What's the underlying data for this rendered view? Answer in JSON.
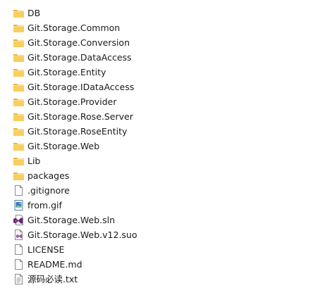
{
  "colors": {
    "folder": "#f5c54a",
    "folder_tab": "#e8b430",
    "text": "#1a1a1a"
  },
  "files": [
    {
      "name": "DB",
      "icon": "folder-icon"
    },
    {
      "name": "Git.Storage.Common",
      "icon": "folder-icon"
    },
    {
      "name": "Git.Storage.Conversion",
      "icon": "folder-icon"
    },
    {
      "name": "Git.Storage.DataAccess",
      "icon": "folder-icon"
    },
    {
      "name": "Git.Storage.Entity",
      "icon": "folder-icon"
    },
    {
      "name": "Git.Storage.IDataAccess",
      "icon": "folder-icon"
    },
    {
      "name": "Git.Storage.Provider",
      "icon": "folder-icon"
    },
    {
      "name": "Git.Storage.Rose.Server",
      "icon": "folder-icon"
    },
    {
      "name": "Git.Storage.RoseEntity",
      "icon": "folder-icon"
    },
    {
      "name": "Git.Storage.Web",
      "icon": "folder-icon"
    },
    {
      "name": "Lib",
      "icon": "folder-icon"
    },
    {
      "name": "packages",
      "icon": "folder-icon"
    },
    {
      "name": ".gitignore",
      "icon": "file-icon"
    },
    {
      "name": "from.gif",
      "icon": "image-file-icon"
    },
    {
      "name": "Git.Storage.Web.sln",
      "icon": "visual-studio-solution-icon"
    },
    {
      "name": "Git.Storage.Web.v12.suo",
      "icon": "visual-studio-suo-icon"
    },
    {
      "name": "LICENSE",
      "icon": "file-icon"
    },
    {
      "name": "README.md",
      "icon": "file-icon"
    },
    {
      "name": "源码必读.txt",
      "icon": "text-file-icon"
    }
  ]
}
